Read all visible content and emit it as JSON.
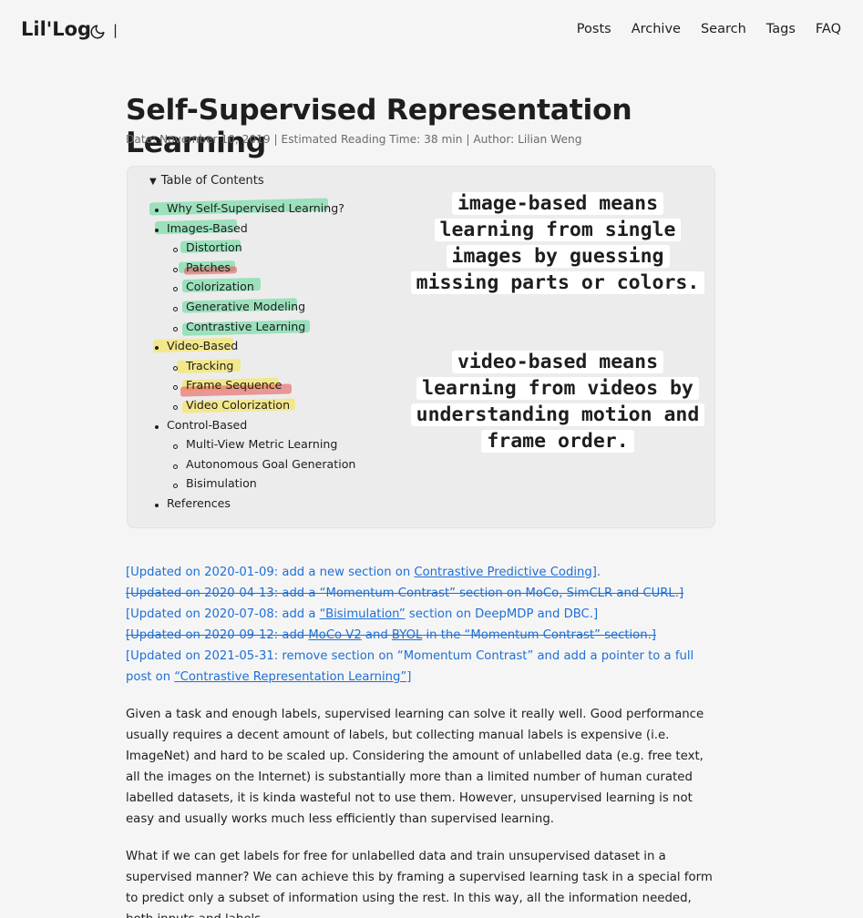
{
  "header": {
    "logo": "Lil'Log",
    "separator": "|",
    "nav": [
      "Posts",
      "Archive",
      "Search",
      "Tags",
      "FAQ"
    ]
  },
  "post": {
    "title": "Self-Supervised Representation Learning",
    "meta": "Date: November 10, 2019  |  Estimated Reading Time: 38 min  |  Author: Lilian Weng"
  },
  "toc": {
    "summary": "Table of Contents",
    "items": {
      "why": "Why Self-Supervised Learning?",
      "images": "Images-Based",
      "distortion": "Distortion",
      "patches": "Patches",
      "colorization": "Colorization",
      "generative": "Generative Modeling",
      "contrastive": "Contrastive Learning",
      "video": "Video-Based",
      "tracking": "Tracking",
      "frame_seq": "Frame Sequence",
      "video_color": "Video Colorization",
      "control": "Control-Based",
      "multiview": "Multi-View Metric Learning",
      "autonomous": "Autonomous Goal Generation",
      "bisim": "Bisimulation",
      "references": "References"
    },
    "annotation_image": "image-based means learning from single images by guessing missing parts or colors.",
    "annotation_video": "video-based means learning from videos by understanding motion and frame order.",
    "highlight_colors": {
      "green": "#48d68c",
      "yellow": "#f6e664",
      "red": "#e85050"
    }
  },
  "updates": {
    "u1_pre": "[Updated on 2020-01-09: add a new section on ",
    "u1_link": "Contrastive Predictive Coding",
    "u1_post": "].",
    "u2": "[Updated on 2020-04-13: add a “Momentum Contrast” section on MoCo, SimCLR and CURL.]",
    "u3_pre": "[Updated on 2020-07-08: add a ",
    "u3_link": "“Bisimulation”",
    "u3_post": " section on DeepMDP and DBC.]",
    "u4_pre": "[Updated on 2020-09-12: add ",
    "u4_link1": "MoCo V2",
    "u4_mid": " and ",
    "u4_link2": "BYOL",
    "u4_post": " in the “Momentum Contrast” section.]",
    "u5_pre": "[Updated on 2021-05-31: remove section on “Momentum Contrast” and add a pointer to a full post on ",
    "u5_link": "“Contrastive Representation Learning”",
    "u5_post": "]",
    "link_color": "#1f6fd6"
  },
  "body": {
    "p1": "Given a task and enough labels, supervised learning can solve it really well. Good performance usually requires a decent amount of labels, but collecting manual labels is expensive (i.e. ImageNet) and hard to be scaled up. Considering the amount of unlabelled data (e.g. free text, all the images on the Internet) is substantially more than a limited number of human curated labelled datasets, it is kinda wasteful not to use them. However, unsupervised learning is not easy and usually works much less efficiently than supervised learning.",
    "p2": "What if we can get labels for free for unlabelled data and train unsupervised dataset in a supervised manner? We can achieve this by framing a supervised learning task in a special form to predict only a subset of information using the rest. In this way, all the information needed, both inputs and labels,"
  }
}
